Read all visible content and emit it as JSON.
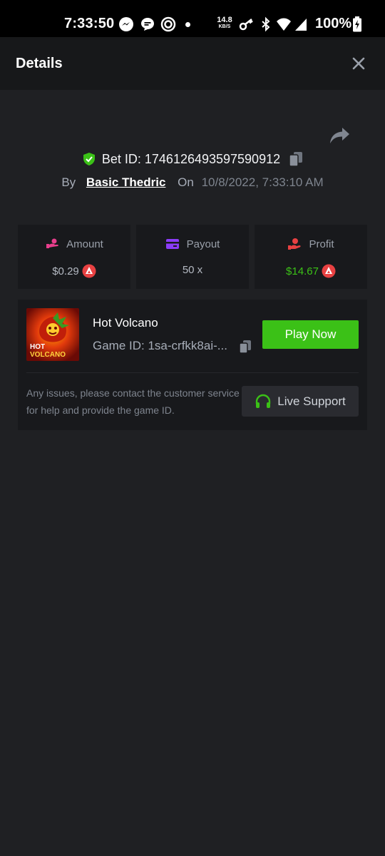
{
  "status_bar": {
    "time": "7:33:50",
    "net_speed_value": "14.8",
    "net_speed_unit": "KB/S",
    "battery": "100%"
  },
  "header": {
    "title": "Details",
    "close_icon": "close-icon"
  },
  "bet": {
    "label": "Bet ID: 1746126493597590912",
    "by_label": "By",
    "user": "Basic Thedric",
    "on_label": "On",
    "date": "10/8/2022, 7:33:10 AM"
  },
  "stats": [
    {
      "label": "Amount",
      "value": "$0.29",
      "icon": "amount-icon",
      "value_color": "#b4b9c2",
      "currency_icon": "avax-coin-icon"
    },
    {
      "label": "Payout",
      "value": "50 x",
      "icon": "payout-card-icon",
      "value_color": "#b4b9c2"
    },
    {
      "label": "Profit",
      "value": "$14.67",
      "icon": "profit-hand-icon",
      "value_color": "#3bc117",
      "currency_icon": "avax-coin-icon"
    }
  ],
  "game": {
    "name": "Hot Volcano",
    "id_text": "Game ID: 1sa-crfkk8ai-...",
    "thumb_text_line1": "HOT",
    "thumb_text_line2": "VOLCANO",
    "play_label": "Play Now"
  },
  "support": {
    "message": "Any issues, please contact the customer service for help and provide the game ID.",
    "button_label": "Live Support"
  },
  "colors": {
    "accent_green": "#3bc117",
    "background": "#1f2023",
    "panel": "#18191c"
  }
}
